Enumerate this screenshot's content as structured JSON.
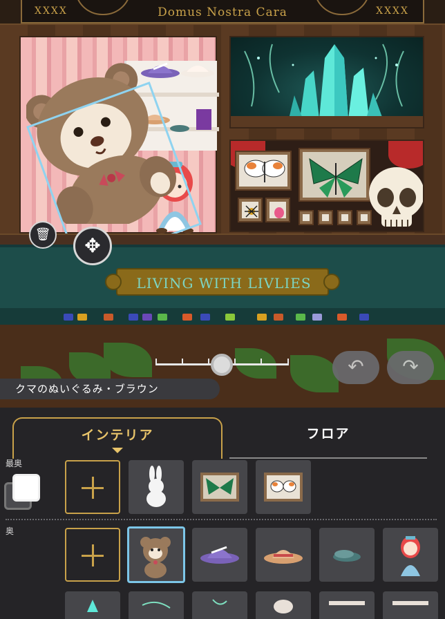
{
  "header": {
    "brand": "Domus Nostra Cara",
    "deco_left": "XXXX",
    "deco_right": "XXXX"
  },
  "counter": {
    "sign_text": "LIVING WITH LIVLIES"
  },
  "selected_item": {
    "name": "クマのぬいぐるみ・ブラウン"
  },
  "tools": {
    "trash_icon": "🗑",
    "move_icon": "✥",
    "undo_icon": "↶",
    "redo_icon": "↷"
  },
  "scale_slider": {
    "ticks": 6,
    "value_index": 3
  },
  "tabs": {
    "interior": "インテリア",
    "floor": "フロア",
    "active": "interior"
  },
  "layers": {
    "back_most": "最奥",
    "back": "奥"
  },
  "row1_items": [
    "add",
    "white-rabbit-figure",
    "green-butterfly-frame",
    "orange-butterfly-frame"
  ],
  "row2_items": [
    "add",
    "brown-teddy-bear",
    "purple-hat",
    "straw-hat",
    "teal-slippers",
    "doll-figure"
  ],
  "colors": {
    "accent_gold": "#c9a24a",
    "selection_blue": "#7cc6e8",
    "panel_bg": "#252427"
  }
}
